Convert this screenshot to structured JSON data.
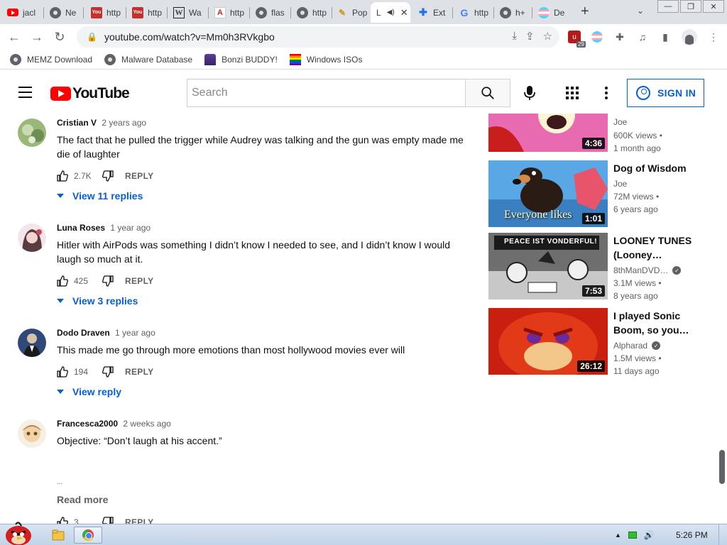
{
  "browser": {
    "tabs": [
      {
        "label": "jacl",
        "icon": "youtube-icon"
      },
      {
        "label": "Ne",
        "icon": "chrome-icon"
      },
      {
        "label": "http",
        "icon": "youtube-old-icon"
      },
      {
        "label": "http",
        "icon": "youtube-old-icon"
      },
      {
        "label": "Wa",
        "icon": "wikipedia-icon"
      },
      {
        "label": "http",
        "icon": "adobe-icon"
      },
      {
        "label": "flas",
        "icon": "globe-icon"
      },
      {
        "label": "http",
        "icon": "globe-icon"
      },
      {
        "label": "Pop",
        "icon": "pop-icon"
      },
      {
        "label": "L",
        "icon": "speaker-icon",
        "active": true
      },
      {
        "label": "Ext",
        "icon": "puzzle-icon"
      },
      {
        "label": "http",
        "icon": "google-icon"
      },
      {
        "label": "h+",
        "icon": "globe-icon"
      },
      {
        "label": "De",
        "icon": "trans-flag-icon"
      }
    ],
    "address": "youtube.com/watch?v=Mm0h3RVkgbo",
    "extension_badge": "29",
    "bookmarks": [
      {
        "label": "MEMZ Download",
        "icon": "globe-icon"
      },
      {
        "label": "Malware Database",
        "icon": "globe-icon"
      },
      {
        "label": "Bonzi BUDDY!",
        "icon": "bonzi-icon"
      },
      {
        "label": "Windows ISOs",
        "icon": "rainbow-flag-icon"
      }
    ]
  },
  "youtube": {
    "logo_text": "YouTube",
    "search_placeholder": "Search",
    "signin_label": "SIGN IN",
    "accent_color": "#065fd4",
    "brand_color": "#ff0000"
  },
  "comments": [
    {
      "author": "Cristian V",
      "date": "2 years ago",
      "text": "The fact that he pulled the trigger while Audrey was talking and the gun was empty made me die of laughter",
      "likes": "2.7K",
      "reply_label": "REPLY",
      "view_replies": "View 11 replies"
    },
    {
      "author": "Luna Roses",
      "date": "1 year ago",
      "text": "Hitler with AirPods was something I didn’t know I needed to see, and I didn’t know I would laugh so much at it.",
      "likes": "425",
      "reply_label": "REPLY",
      "view_replies": "View 3 replies"
    },
    {
      "author": "Dodo Draven",
      "date": "1 year ago",
      "text": "This made me go through more emotions than most hollywood movies ever will",
      "likes": "194",
      "reply_label": "REPLY",
      "view_replies": "View reply"
    },
    {
      "author": "Francesca2000",
      "date": "2 weeks ago",
      "text": "Objective: “Don’t laugh at his accent.”",
      "ellipsis": "...",
      "read_more": "Read more",
      "likes": "3",
      "reply_label": "REPLY"
    }
  ],
  "sidebar": [
    {
      "title": "",
      "channel": "Joe",
      "verified": false,
      "views": "600K views",
      "age": "1 month ago",
      "duration": "4:36"
    },
    {
      "title": "Dog of Wisdom",
      "channel": "Joe",
      "verified": false,
      "views": "72M views",
      "age": "6 years ago",
      "duration": "1:01",
      "thumb_caption": "Everyone likes"
    },
    {
      "title": "LOONEY TUNES (Looney…",
      "channel": "8thManDVD…",
      "verified": true,
      "views": "3.1M views",
      "age": "8 years ago",
      "duration": "7:53",
      "thumb_caption": "PEACE IST VONDERFUL!"
    },
    {
      "title": "I played Sonic Boom, so you…",
      "channel": "Alpharad",
      "verified": true,
      "views": "1.5M views",
      "age": "11 days ago",
      "duration": "26:12"
    }
  ],
  "taskbar": {
    "clock": "5:26 PM"
  }
}
